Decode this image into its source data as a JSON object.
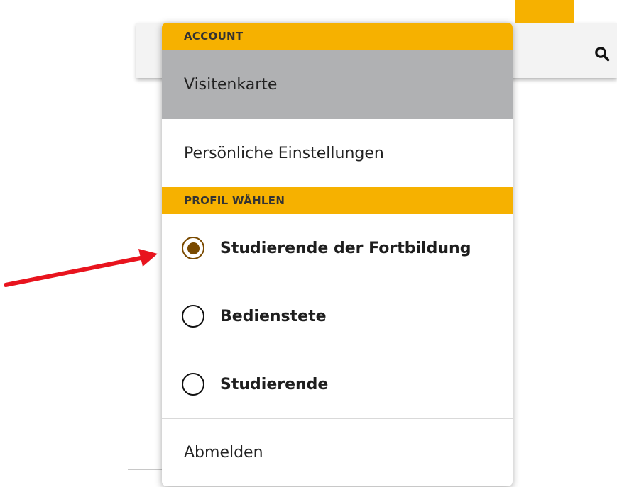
{
  "header": {
    "search_icon": "search-icon"
  },
  "menu": {
    "account_header": "ACCOUNT",
    "items": [
      {
        "label": "Visitenkarte",
        "active": true
      },
      {
        "label": "Persönliche Einstellungen",
        "active": false
      }
    ],
    "profile_header": "PROFIL WÄHLEN",
    "profiles": [
      {
        "label": "Studierende der Fortbildung",
        "selected": true
      },
      {
        "label": "Bedienstete",
        "selected": false
      },
      {
        "label": "Studierende",
        "selected": false
      }
    ],
    "logout_label": "Abmelden"
  },
  "colors": {
    "accent": "#f6b100",
    "active_item_bg": "#b0b1b3",
    "radio_selected": "#7a4a00",
    "annotation_arrow": "#e8141e"
  }
}
